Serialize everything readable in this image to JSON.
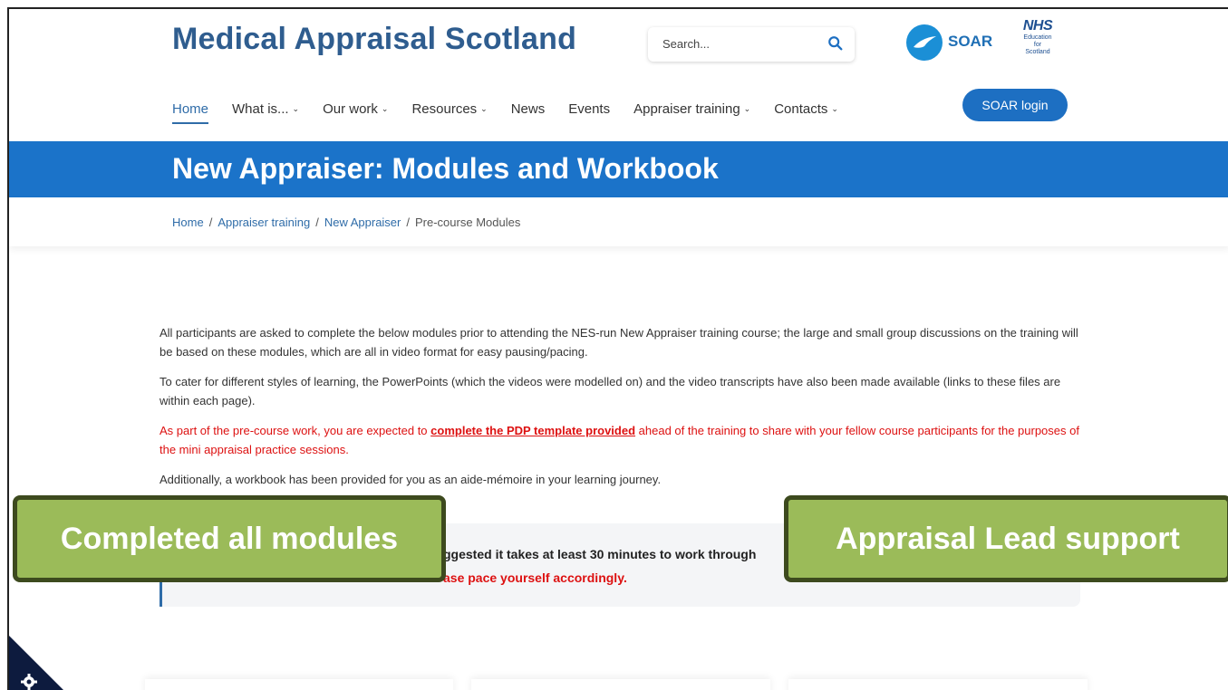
{
  "header": {
    "site_title": "Medical Appraisal Scotland",
    "search_placeholder": "Search...",
    "soar_logo_text": "SOAR",
    "nhs_logo": {
      "mark": "NHS",
      "line1": "Education",
      "line2": "for",
      "line3": "Scotland"
    }
  },
  "nav": {
    "items": [
      {
        "label": "Home",
        "dropdown": false,
        "active": true
      },
      {
        "label": "What is...",
        "dropdown": true
      },
      {
        "label": "Our work",
        "dropdown": true
      },
      {
        "label": "Resources",
        "dropdown": true
      },
      {
        "label": "News",
        "dropdown": false
      },
      {
        "label": "Events",
        "dropdown": false
      },
      {
        "label": "Appraiser training",
        "dropdown": true
      },
      {
        "label": "Contacts",
        "dropdown": true
      }
    ],
    "login_label": "SOAR login"
  },
  "banner": {
    "title": "New Appraiser: Modules and Workbook"
  },
  "breadcrumb": {
    "items": [
      "Home",
      "Appraiser training",
      "New Appraiser"
    ],
    "current": "Pre-course Modules",
    "separator": "/"
  },
  "content": {
    "p1": "All participants are asked to complete the below modules prior to attending the NES-run New Appraiser training course; the large and small group discussions on the training will be based on these modules, which are all in video format for easy pausing/pacing.",
    "p2": "To cater for different styles of learning, the PowerPoints (which the videos were modelled on) and the video transcripts have also been made available (links to these files are within each page).",
    "p3_before": "As part of the pre-course work, you are expected to ",
    "p3_link": "complete the PDP template provided",
    "p3_after": " ahead of the training to share with your fellow course participants for the purposes of the mini appraisal practice sessions.",
    "p4": "Additionally, a workbook has been provided for you as an aide-mémoire in your learning journey."
  },
  "callout": {
    "line1": "ggested it takes at least 30 minutes to work through",
    "line2": "ase pace yourself accordingly."
  },
  "overlays": {
    "left": "Completed all modules",
    "right": "Appraisal Lead support"
  },
  "colors": {
    "brand_blue": "#1b73c9",
    "title_blue": "#2f5d8f",
    "overlay_green": "#9bbb59",
    "warning_red": "#dd1111"
  }
}
